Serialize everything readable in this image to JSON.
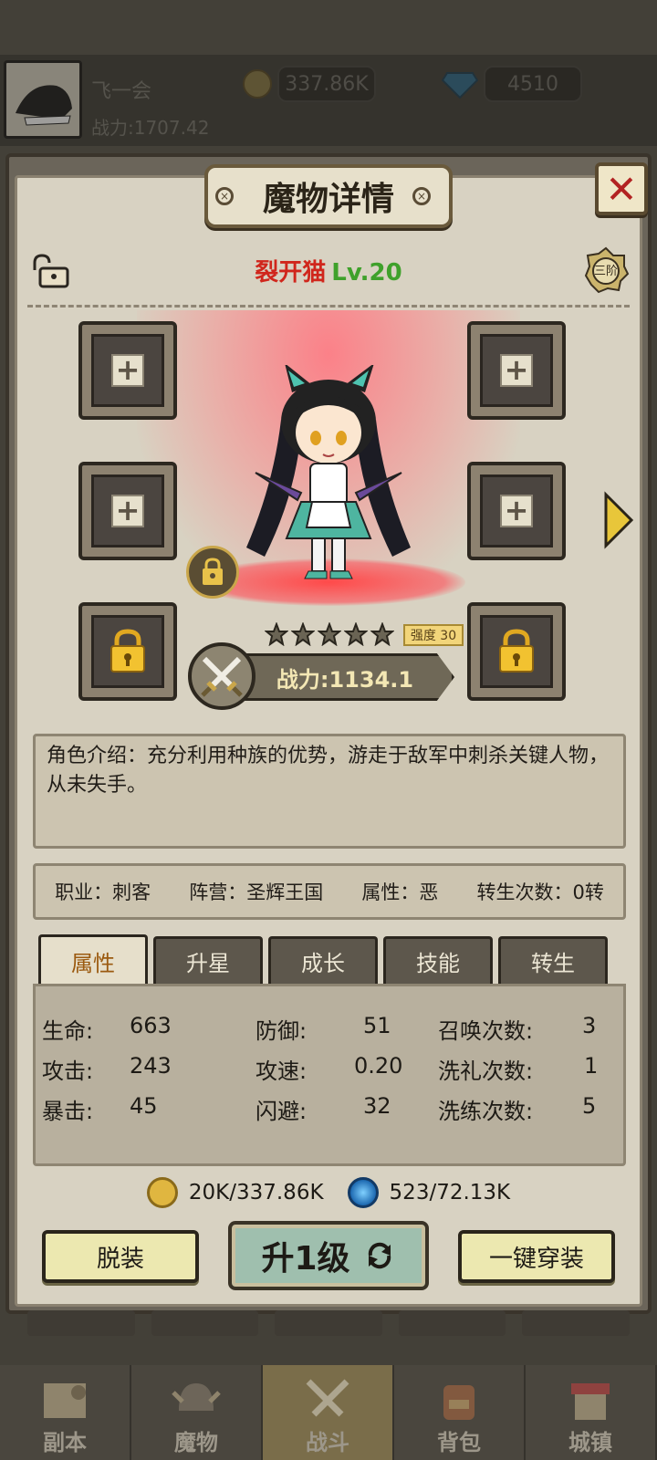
{
  "header": {
    "player_name": "飞一会",
    "power": "战力:1707.42",
    "gold": "337.86K",
    "diamond": "4510"
  },
  "dialog": {
    "title": "魔物详情",
    "close": "✕",
    "monster_name": "裂开猫",
    "monster_level": "Lv.20",
    "rank": "三阶",
    "strength": "强度 30",
    "stars": 5,
    "power": "战力:1134.1",
    "description": "角色介绍：充分利用种族的优势，游走于敌军中刺杀关键人物，从未失手。",
    "info": {
      "job": "职业：刺客",
      "camp": "阵营：圣辉王国",
      "attr": "属性：恶",
      "rebirth": "转生次数：0转"
    },
    "tabs": [
      "属性",
      "升星",
      "成长",
      "技能",
      "转生"
    ],
    "stats": {
      "hp_label": "生命:",
      "hp": "663",
      "atk_label": "攻击:",
      "atk": "243",
      "crit_label": "暴击:",
      "crit": "45",
      "def_label": "防御:",
      "def": "51",
      "spd_label": "攻速:",
      "spd": "0.20",
      "dodge_label": "闪避:",
      "dodge": "32",
      "summon_label": "召唤次数:",
      "summon": "3",
      "bapt_label": "洗礼次数:",
      "bapt": "1",
      "refine_label": "洗练次数:",
      "refine": "5"
    },
    "cost_gold": "20K/337.86K",
    "cost_orb": "523/72.13K",
    "unequip": "脱装",
    "levelup": "升1级",
    "equip_all": "一键穿装"
  },
  "nav": [
    "副本",
    "魔物",
    "战斗",
    "背包",
    "城镇"
  ],
  "colors": {
    "name_red": "#d0261c",
    "level_green": "#3fa12b",
    "active_tab_text": "#9b5a10"
  }
}
